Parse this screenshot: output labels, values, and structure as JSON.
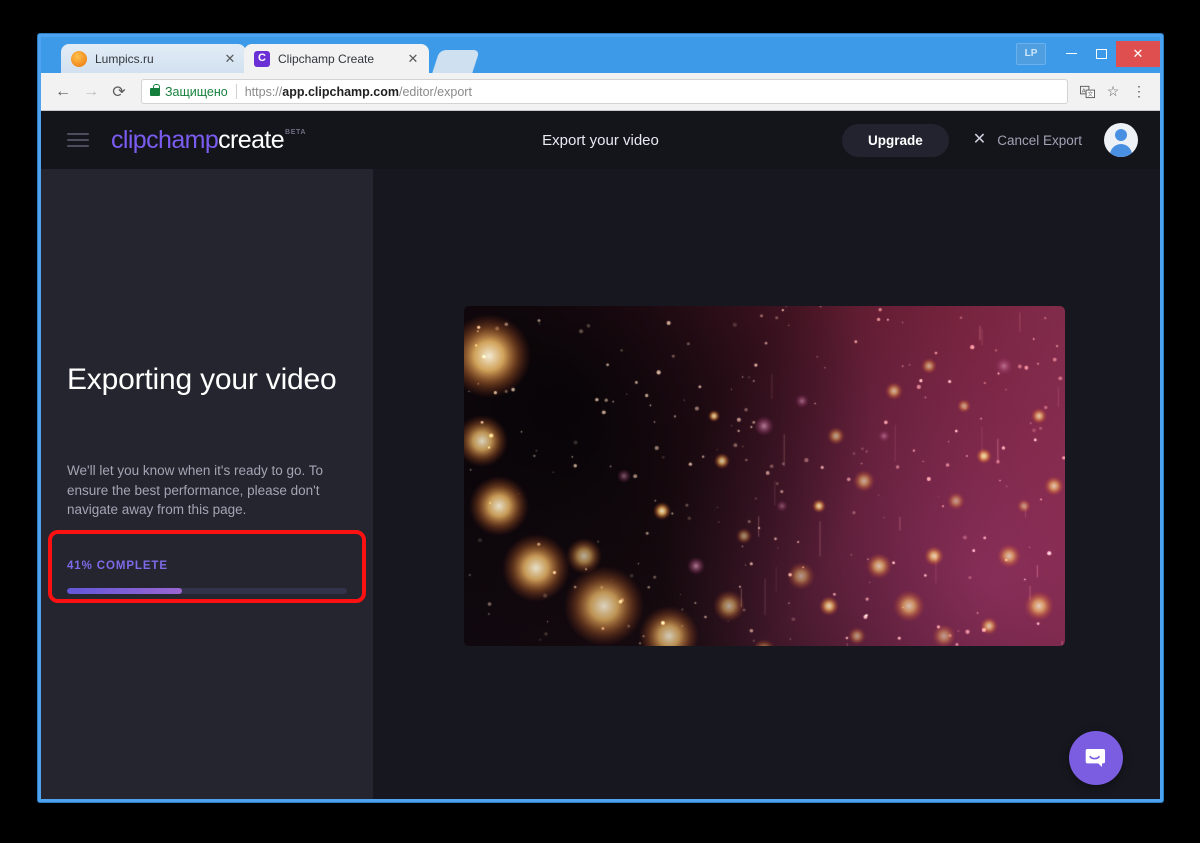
{
  "browser": {
    "tabs": [
      {
        "title": "Lumpics.ru",
        "favicon": "orange-circle-icon",
        "active": false,
        "close": "✕"
      },
      {
        "title": "Clipchamp Create",
        "favicon": "clipchamp-c-icon",
        "favicon_letter": "C",
        "active": true,
        "close": "✕"
      }
    ],
    "window_controls": {
      "profile_badge": "LP",
      "minimize": "minimize-icon",
      "maximize": "maximize-icon",
      "close": "✕"
    },
    "nav": {
      "back": "←",
      "forward": "→",
      "reload": "⟳"
    },
    "omnibox": {
      "security_label": "Защищено",
      "url_scheme": "https://",
      "url_host": "app.clipchamp.com",
      "url_path": "/editor/export"
    },
    "toolbar_icons": {
      "translate": "語",
      "bookmark": "☆",
      "menu": "⋮"
    }
  },
  "app": {
    "header": {
      "menu_icon": "hamburger-icon",
      "logo_primary": "clipchamp",
      "logo_secondary": "create",
      "logo_badge": "BETA",
      "title": "Export your video",
      "upgrade_label": "Upgrade",
      "cancel_label": "Cancel Export",
      "cancel_icon": "✕",
      "avatar": "user-avatar"
    },
    "sidebar": {
      "heading": "Exporting your video",
      "description": "We'll let you know when it's ready to go.\nTo ensure the best performance, please don't navigate away from this page.",
      "progress_label": "41% COMPLETE",
      "progress_percent": 41
    },
    "stage": {
      "preview_alt": "video-preview-bokeh-lights",
      "chat_launcher": "intercom-chat-icon"
    }
  },
  "colors": {
    "accent_purple": "#7b5cf0",
    "progress_text": "#7d6ae8",
    "annotation_red": "#fb1111",
    "sidebar_bg": "#25252f",
    "stage_bg": "#17171f",
    "header_bg": "#14141b",
    "browser_chrome": "#3d9ae8"
  }
}
